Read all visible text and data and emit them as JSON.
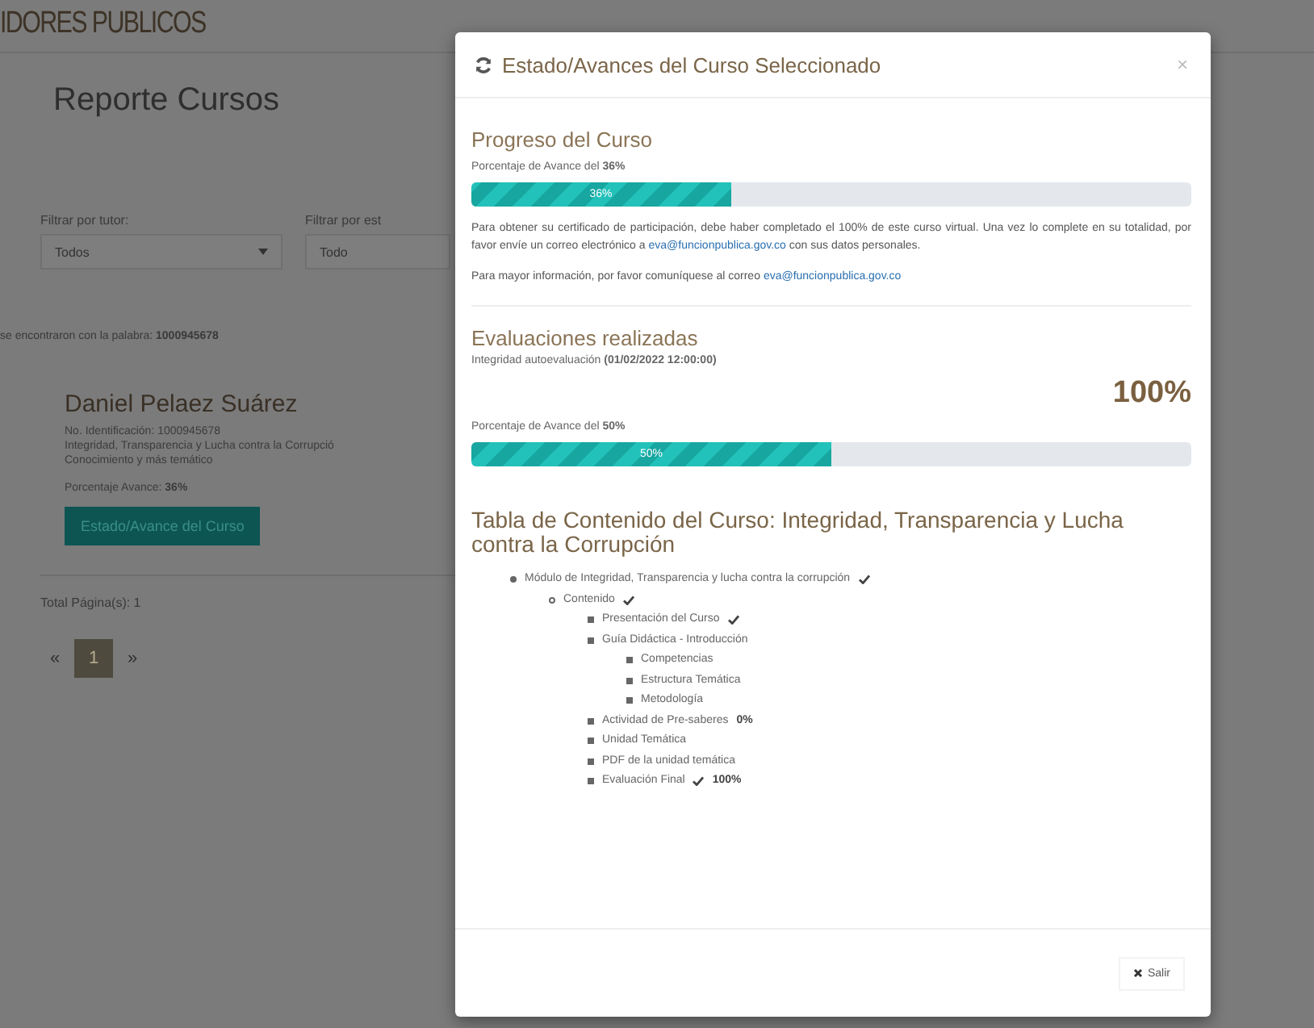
{
  "page": {
    "brand": "IDORES PUBLICOS",
    "title": "Reporte Cursos",
    "filters": [
      {
        "label": "Filtrar por tutor:",
        "value": "Todos"
      },
      {
        "label": "Filtrar por est",
        "value": "Todo"
      }
    ],
    "search_note": {
      "text": "se encontraron con la palabra:",
      "term": "1000945678"
    },
    "result": {
      "name": "Daniel Pelaez Suárez",
      "lines": [
        "No. Identificación: 1000945678",
        "Integridad, Transparencia y Lucha contra la Corrupció",
        "Conocimiento y más temático"
      ],
      "progress_label": "Porcentaje Avance:",
      "progress_value": "36%",
      "button": "Estado/Avance del Curso"
    },
    "total_pages": "Total Página(s): 1",
    "pagination": [
      {
        "label": "«",
        "selected": false
      },
      {
        "label": "1",
        "selected": true
      },
      {
        "label": "»",
        "selected": false
      }
    ]
  },
  "modal": {
    "title": "Estado/Avances del Curso Seleccionado",
    "close": "×",
    "progress": {
      "heading": "Progreso del Curso",
      "label": "Porcentaje de Avance del",
      "value": "36%",
      "level": 0.36,
      "bar_text": "36%",
      "note": "Para obtener su certificado de participación, debe haber completado el 100% de este curso virtual. Una vez lo complete en su totalidad, por favor envíe un correo electrónico a",
      "note_link": "eva@funcionpublica.gov.co",
      "note_end": "con sus datos personales.",
      "info": "Para mayor información, por favor comuníquese al correo",
      "info_link": "eva@funcionpublica.gov.co"
    },
    "evaluations": {
      "heading": "Evaluaciones realizadas",
      "name": "Integridad autoevaluación",
      "date": "(01/02/2022 12:00:00)",
      "score": "100%",
      "label": "Porcentaje de Avance del",
      "value": "50%",
      "level": 0.5,
      "bar_text": "50%"
    },
    "contents": {
      "heading": "Tabla de Contenido del Curso: Integridad, Transparencia y Lucha contra la Corrupción",
      "items": [
        {
          "label": "Módulo de Integridad, Transparencia y lucha contra la corrupción",
          "done": true,
          "children": [
            {
              "label": "Contenido",
              "done": true,
              "children": [
                {
                  "label": "Presentación del Curso",
                  "done": true
                },
                {
                  "label": "Guía Didáctica - Introducción",
                  "done": false,
                  "children": [
                    {
                      "label": "Competencias",
                      "done": false
                    },
                    {
                      "label": "Estructura Temática",
                      "done": false
                    },
                    {
                      "label": "Metodología",
                      "done": false
                    }
                  ]
                },
                {
                  "label": "Actividad de Pre-saberes",
                  "done": false,
                  "score": "0%"
                },
                {
                  "label": "Unidad Temática",
                  "done": false
                },
                {
                  "label": "PDF de la unidad temática",
                  "done": false
                },
                {
                  "label": "Evaluación Final",
                  "done": true,
                  "score": "100%"
                }
              ]
            }
          ]
        }
      ]
    },
    "exit_button": "Salir"
  }
}
